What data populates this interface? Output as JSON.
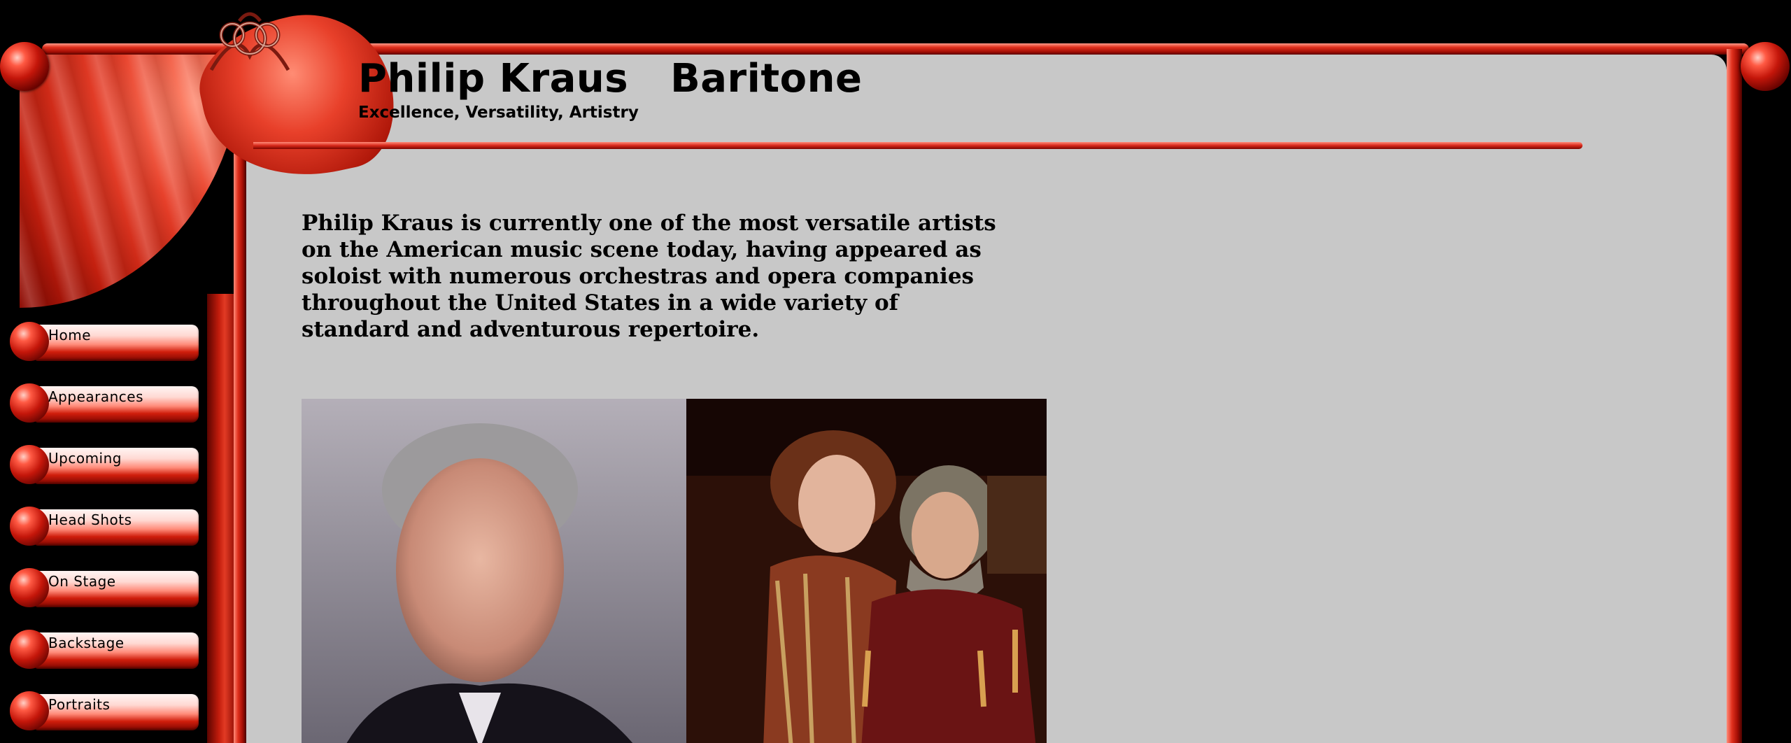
{
  "header": {
    "title": "Philip Kraus   Baritone",
    "tagline": "Excellence, Versatility, Artistry"
  },
  "intro": {
    "text": "Philip Kraus is currently one of the most versatile artists on the American music scene today, having appeared as soloist with numerous orchestras and opera companies throughout the United States in a wide variety of standard and adventurous repertoire."
  },
  "nav": {
    "items": [
      {
        "label": "Home"
      },
      {
        "label": "Appearances"
      },
      {
        "label": "Upcoming"
      },
      {
        "label": "Head Shots"
      },
      {
        "label": "On Stage"
      },
      {
        "label": "Backstage"
      },
      {
        "label": "Portraits"
      }
    ]
  },
  "colors": {
    "frame_red": "#e0301d",
    "panel_gray": "#c8c8c8",
    "background": "#000000"
  }
}
